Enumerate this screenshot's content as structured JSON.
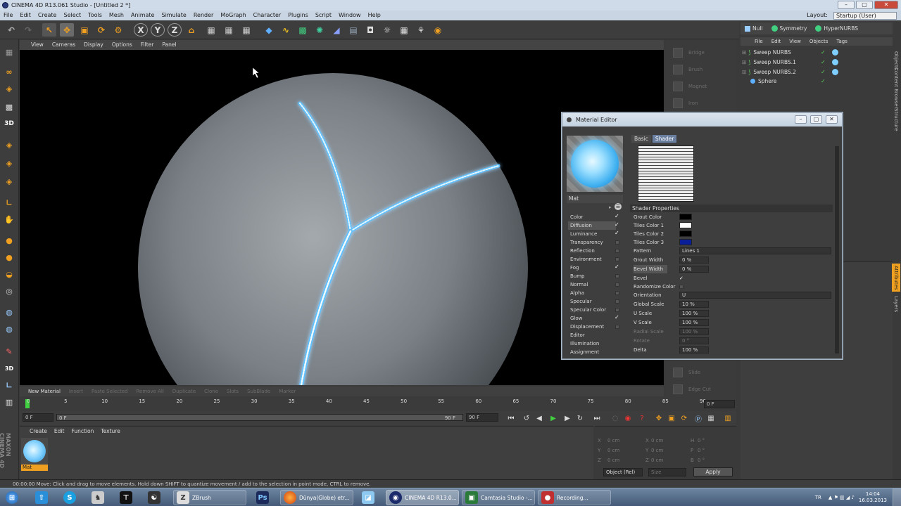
{
  "window": {
    "title": "CINEMA 4D R13.061 Studio - [Untitled 2 *]"
  },
  "menu": [
    "File",
    "Edit",
    "Create",
    "Select",
    "Tools",
    "Mesh",
    "Animate",
    "Simulate",
    "Render",
    "MoGraph",
    "Character",
    "Plugins",
    "Script",
    "Window",
    "Help"
  ],
  "layout": {
    "label": "Layout:",
    "value": "Startup (User)"
  },
  "viewport": {
    "menu": [
      "View",
      "Cameras",
      "Display",
      "Options",
      "Filter",
      "Panel"
    ]
  },
  "object_manager": {
    "top_buttons": [
      "Null",
      "Symmetry",
      "HyperNURBS"
    ],
    "menu": [
      "File",
      "Edit",
      "View",
      "Objects",
      "Tags"
    ],
    "objects": [
      "Sweep NURBS",
      "Sweep NURBS.1",
      "Sweep NURBS.2",
      "Sphere"
    ]
  },
  "side_panel": [
    "Bridge",
    "Brush",
    "Magnet",
    "Iron",
    "Slide",
    "Edge Cut"
  ],
  "vertical_tabs": {
    "right": [
      "Objects",
      "Content Browser",
      "Structure"
    ],
    "attr": [
      "Attributes",
      "Layers"
    ],
    "left_logo": "MAXON CINEMA 4D"
  },
  "material_bar": [
    "New Material",
    "Insert",
    "Paste Selected",
    "Remove All",
    "Duplicate",
    "Clone",
    "Slots",
    "SubBlade",
    "Marker"
  ],
  "timeline": {
    "ticks": [
      "0",
      "5",
      "10",
      "15",
      "20",
      "25",
      "30",
      "35",
      "40",
      "45",
      "50",
      "55",
      "60",
      "65",
      "70",
      "75",
      "80",
      "85",
      "90"
    ],
    "current_frame": "0 F"
  },
  "transport": {
    "start": "0 F",
    "range_start": "0 F",
    "range_end": "90 F",
    "end": "90 F"
  },
  "material_manager": {
    "menu": [
      "Create",
      "Edit",
      "Function",
      "Texture"
    ],
    "material_name": "Mat"
  },
  "coordinates": {
    "rows": [
      {
        "axis": "X",
        "pos": "0 cm",
        "size": "0 cm",
        "rot_axis": "H",
        "rot": "0 °"
      },
      {
        "axis": "Y",
        "pos": "0 cm",
        "size": "0 cm",
        "rot_axis": "P",
        "rot": "0 °"
      },
      {
        "axis": "Z",
        "pos": "0 cm",
        "size": "0 cm",
        "rot_axis": "B",
        "rot": "0 °"
      }
    ],
    "mode": "Object (Rel)",
    "size_mode": "Size",
    "apply": "Apply"
  },
  "material_editor": {
    "title": "Material Editor",
    "name": "Mat",
    "tabs": [
      "Basic",
      "Shader"
    ],
    "channels": [
      {
        "label": "Color",
        "checked": true
      },
      {
        "label": "Diffusion",
        "checked": true
      },
      {
        "label": "Luminance",
        "checked": true
      },
      {
        "label": "Transparency",
        "checked": false
      },
      {
        "label": "Reflection",
        "checked": false
      },
      {
        "label": "Environment",
        "checked": false
      },
      {
        "label": "Fog",
        "checked": true
      },
      {
        "label": "Bump",
        "checked": false
      },
      {
        "label": "Normal",
        "checked": false
      },
      {
        "label": "Alpha",
        "checked": false
      },
      {
        "label": "Specular",
        "checked": false
      },
      {
        "label": "Specular Color",
        "checked": false
      },
      {
        "label": "Glow",
        "checked": true
      },
      {
        "label": "Displacement",
        "checked": false
      },
      {
        "label": "Editor",
        "checked": null
      },
      {
        "label": "Illumination",
        "checked": null
      },
      {
        "label": "Assignment",
        "checked": null
      }
    ],
    "shader_properties_header": "Shader Properties",
    "properties": {
      "grout_color": {
        "label": "Grout Color",
        "color": "#000000"
      },
      "tiles_color_1": {
        "label": "Tiles Color 1",
        "color": "#ffffff"
      },
      "tiles_color_2": {
        "label": "Tiles Color 2",
        "color": "#000000"
      },
      "tiles_color_3": {
        "label": "Tiles Color 3",
        "color": "#0a1e9a"
      },
      "pattern": {
        "label": "Pattern",
        "value": "Lines 1"
      },
      "grout_width": {
        "label": "Grout Width",
        "value": "0 %"
      },
      "bevel_width": {
        "label": "Bevel Width",
        "value": "0 %"
      },
      "bevel": {
        "label": "Bevel",
        "checked": true
      },
      "randomize_color": {
        "label": "Randomize Color",
        "checked": false
      },
      "orientation": {
        "label": "Orientation",
        "value": "U"
      },
      "global_scale": {
        "label": "Global Scale",
        "value": "10 %"
      },
      "u_scale": {
        "label": "U Scale",
        "value": "100 %"
      },
      "v_scale": {
        "label": "V Scale",
        "value": "100 %"
      },
      "radial_scale": {
        "label": "Radial Scale",
        "value": "100 %"
      },
      "rotate": {
        "label": "Rotate",
        "value": "0 °"
      },
      "delta": {
        "label": "Delta",
        "value": "100 %"
      }
    }
  },
  "status": "00:00:00    Move: Click and drag to move elements. Hold down SHIFT to quantize movement / add to the selection in point mode, CTRL to remove.",
  "taskbar": {
    "tasks": [
      "ZBrush",
      "Dünya(Globe) etr...",
      "CINEMA 4D R13.0...",
      "Camtasia Studio -...",
      "Recording..."
    ],
    "tray": {
      "lang": "TR",
      "time": "14:04",
      "date": "16.03.2013"
    }
  },
  "colors": {
    "accent_orange": "#f0a020",
    "glow_blue": "#7ecfff",
    "c4d_bg": "#3a3a3a"
  }
}
